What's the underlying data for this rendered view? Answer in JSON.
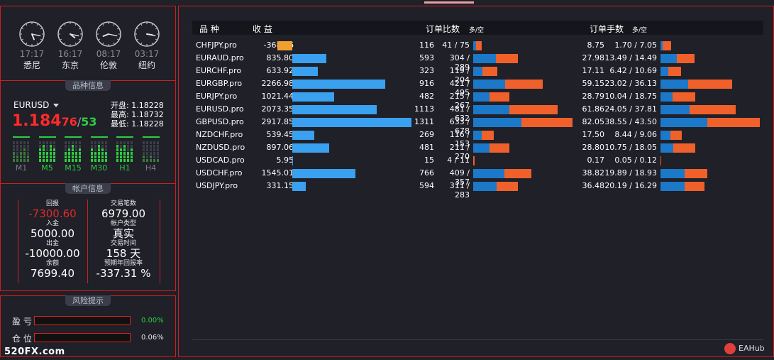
{
  "clocks": [
    {
      "time": "17:17",
      "city": "悉尼",
      "h": 17,
      "m": 17
    },
    {
      "time": "16:17",
      "city": "东京",
      "h": 16,
      "m": 17
    },
    {
      "time": "08:17",
      "city": "伦敦",
      "h": 8,
      "m": 17
    },
    {
      "time": "03:17",
      "city": "纽约",
      "h": 3,
      "m": 17
    }
  ],
  "symbol_panel": {
    "title": "品种信息",
    "symbol": "EURUSD",
    "price_main": "1.184",
    "price_pip": "76",
    "price_sep": "/",
    "price_ask": "53",
    "open_label": "开盘:",
    "open": "1.18228",
    "high_label": "最高:",
    "high": "1.18732",
    "low_label": "最低:",
    "low": "1.18228",
    "timeframes": [
      {
        "label": "M1",
        "active": false
      },
      {
        "label": "M5",
        "active": true
      },
      {
        "label": "M15",
        "active": true
      },
      {
        "label": "M30",
        "active": true
      },
      {
        "label": "H1",
        "active": true
      },
      {
        "label": "H4",
        "active": false
      }
    ]
  },
  "account_panel": {
    "title": "帐户信息",
    "left": [
      {
        "label": "回报",
        "value": "-7300.60",
        "red": true
      },
      {
        "label": "入金",
        "value": "5000.00"
      },
      {
        "label": "出金",
        "value": "-10000.00"
      },
      {
        "label": "余额",
        "value": "7699.40"
      }
    ],
    "right": [
      {
        "label": "交易笔数",
        "value": "6979.00"
      },
      {
        "label": "帐户类型",
        "value": "真实"
      },
      {
        "label": "交易时间",
        "value": "158 天"
      },
      {
        "label": "预期年回报率",
        "value": "-337.31 %"
      }
    ]
  },
  "risk_panel": {
    "title": "风险提示",
    "rows": [
      {
        "label": "盈 亏",
        "value": "0.00%",
        "green": true
      },
      {
        "label": "仓 位",
        "value": "0.06%",
        "green": false
      }
    ]
  },
  "table": {
    "headers": {
      "symbol": "品 种",
      "profit": "收 益",
      "ratio": "订单比数",
      "ratio_sub": "多/空",
      "lots": "订单手数",
      "lots_sub": "多/空"
    },
    "colors": {
      "profit": "#3aa0f0",
      "loss": "#f0a030",
      "long": "#1c78c8",
      "short": "#f0602a"
    },
    "rows": [
      {
        "symbol": "CHFJPY.pro",
        "profit": "-368.56",
        "p": -368.56,
        "count": "116",
        "ls": "41 / 75",
        "l": 41,
        "s": 75,
        "lots": "8.75",
        "lls": "1.70 / 7.05",
        "ll": 1.7,
        "sl": 7.05
      },
      {
        "symbol": "EURAUD.pro",
        "profit": "835.80",
        "p": 835.8,
        "count": "593",
        "ls": "304 / 289",
        "l": 304,
        "s": 289,
        "lots": "27.98",
        "lls": "13.49 / 14.49",
        "ll": 13.49,
        "sl": 14.49
      },
      {
        "symbol": "EURCHF.pro",
        "profit": "633.92",
        "p": 633.92,
        "count": "323",
        "ls": "119 / 204",
        "l": 119,
        "s": 204,
        "lots": "17.11",
        "lls": "6.42 / 10.69",
        "ll": 6.42,
        "sl": 10.69
      },
      {
        "symbol": "EURGBP.pro",
        "profit": "2266.98",
        "p": 2266.98,
        "count": "916",
        "ls": "421 / 495",
        "l": 421,
        "s": 495,
        "lots": "59.15",
        "lls": "23.02 / 36.13",
        "ll": 23.02,
        "sl": 36.13
      },
      {
        "symbol": "EURJPY.pro",
        "profit": "1021.44",
        "p": 1021.44,
        "count": "482",
        "ls": "215 / 267",
        "l": 215,
        "s": 267,
        "lots": "28.79",
        "lls": "10.04 / 18.75",
        "ll": 10.04,
        "sl": 18.75
      },
      {
        "symbol": "EURUSD.pro",
        "profit": "2073.35",
        "p": 2073.35,
        "count": "1113",
        "ls": "481 / 632",
        "l": 481,
        "s": 632,
        "lots": "61.86",
        "lls": "24.05 / 37.81",
        "ll": 24.05,
        "sl": 37.81
      },
      {
        "symbol": "GBPUSD.pro",
        "profit": "2917.85",
        "p": 2917.85,
        "count": "1311",
        "ls": "633 / 678",
        "l": 633,
        "s": 678,
        "lots": "82.05",
        "lls": "38.55 / 43.50",
        "ll": 38.55,
        "sl": 43.5
      },
      {
        "symbol": "NZDCHF.pro",
        "profit": "539.45",
        "p": 539.45,
        "count": "269",
        "ls": "116 / 153",
        "l": 116,
        "s": 153,
        "lots": "17.50",
        "lls": "8.44 / 9.06",
        "ll": 8.44,
        "sl": 9.06
      },
      {
        "symbol": "NZDUSD.pro",
        "profit": "897.06",
        "p": 897.06,
        "count": "481",
        "ls": "211 / 270",
        "l": 211,
        "s": 270,
        "lots": "28.80",
        "lls": "10.75 / 18.05",
        "ll": 10.75,
        "sl": 18.05
      },
      {
        "symbol": "USDCAD.pro",
        "profit": "5.95",
        "p": 5.95,
        "count": "15",
        "ls": "4 / 11",
        "l": 4,
        "s": 11,
        "lots": "0.17",
        "lls": "0.05 / 0.12",
        "ll": 0.05,
        "sl": 0.12
      },
      {
        "symbol": "USDCHF.pro",
        "profit": "1545.01",
        "p": 1545.01,
        "count": "766",
        "ls": "409 / 357",
        "l": 409,
        "s": 357,
        "lots": "38.82",
        "lls": "19.89 / 18.93",
        "ll": 19.89,
        "sl": 18.93
      },
      {
        "symbol": "USDJPY.pro",
        "profit": "331.15",
        "p": 331.15,
        "count": "594",
        "ls": "311 / 283",
        "l": 311,
        "s": 283,
        "lots": "36.48",
        "lls": "20.19 / 16.29",
        "ll": 20.19,
        "sl": 16.29
      }
    ]
  },
  "branding": {
    "site": "520FX.com",
    "hub": "EAHub"
  }
}
